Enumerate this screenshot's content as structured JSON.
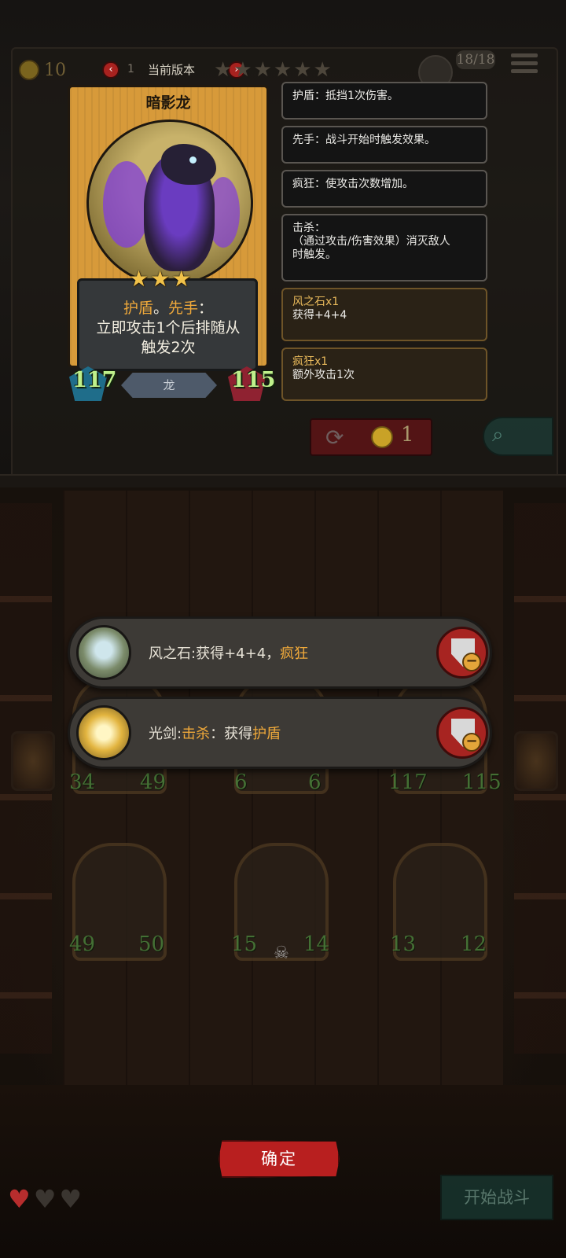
{
  "hud": {
    "gold": "10",
    "version_label": "当前版本",
    "version_level": "1",
    "stars": "★★★★★★",
    "round": "18/18"
  },
  "card": {
    "name": "暗影龙",
    "stars": "★★★",
    "desc_kw1": "护盾",
    "desc_sep": "。",
    "desc_kw2": "先手",
    "desc_colon": "：",
    "desc_line2": "立即攻击1个后排随从",
    "desc_line3": "触发2次",
    "type": "龙",
    "attack": "117",
    "health": "115"
  },
  "tooltips": [
    {
      "text": "护盾：抵挡1次伤害。"
    },
    {
      "text": "先手：战斗开始时触发效果。"
    },
    {
      "text": "疯狂：使攻击次数增加。"
    },
    {
      "line1": "击杀：",
      "line2": "（通过攻击/伤害效果）消灭敌人",
      "line3": "时触发。"
    }
  ],
  "buffs": [
    {
      "title": "风之石x1",
      "text": "获得+4+4"
    },
    {
      "title": "疯狂x1",
      "text": "额外攻击1次"
    }
  ],
  "reroll": {
    "cost": "1"
  },
  "board": {
    "row1": [
      {
        "atk": "34",
        "hp": "49"
      },
      {
        "atk": "6",
        "hp": "6"
      },
      {
        "atk": "117",
        "hp": "115"
      }
    ],
    "row2": [
      {
        "atk": "49",
        "hp": "50"
      },
      {
        "atk": "15",
        "hp": "14"
      },
      {
        "atk": "13",
        "hp": "12"
      }
    ]
  },
  "equipment": [
    {
      "name": "风之石",
      "sep": ":",
      "plain": "获得+4+4，",
      "kw": "疯狂",
      "rest": ""
    },
    {
      "name": "光剑",
      "sep": ":",
      "plain": "",
      "kw": "击杀",
      "rest": "：获得",
      "kw2": "护盾"
    }
  ],
  "buttons": {
    "confirm": "确定",
    "start_battle": "开始战斗"
  },
  "icons": {
    "gold": "coin-icon",
    "reroll": "refresh-icon",
    "search": "search-icon",
    "remove": "shield-minus-icon",
    "menu": "hamburger-icon",
    "life": "heart-icon"
  },
  "colors": {
    "keyword": "#f0a93a",
    "card_frame": "#d79a3a",
    "confirm": "#b81f1f",
    "attack_text": "#bff08b"
  }
}
